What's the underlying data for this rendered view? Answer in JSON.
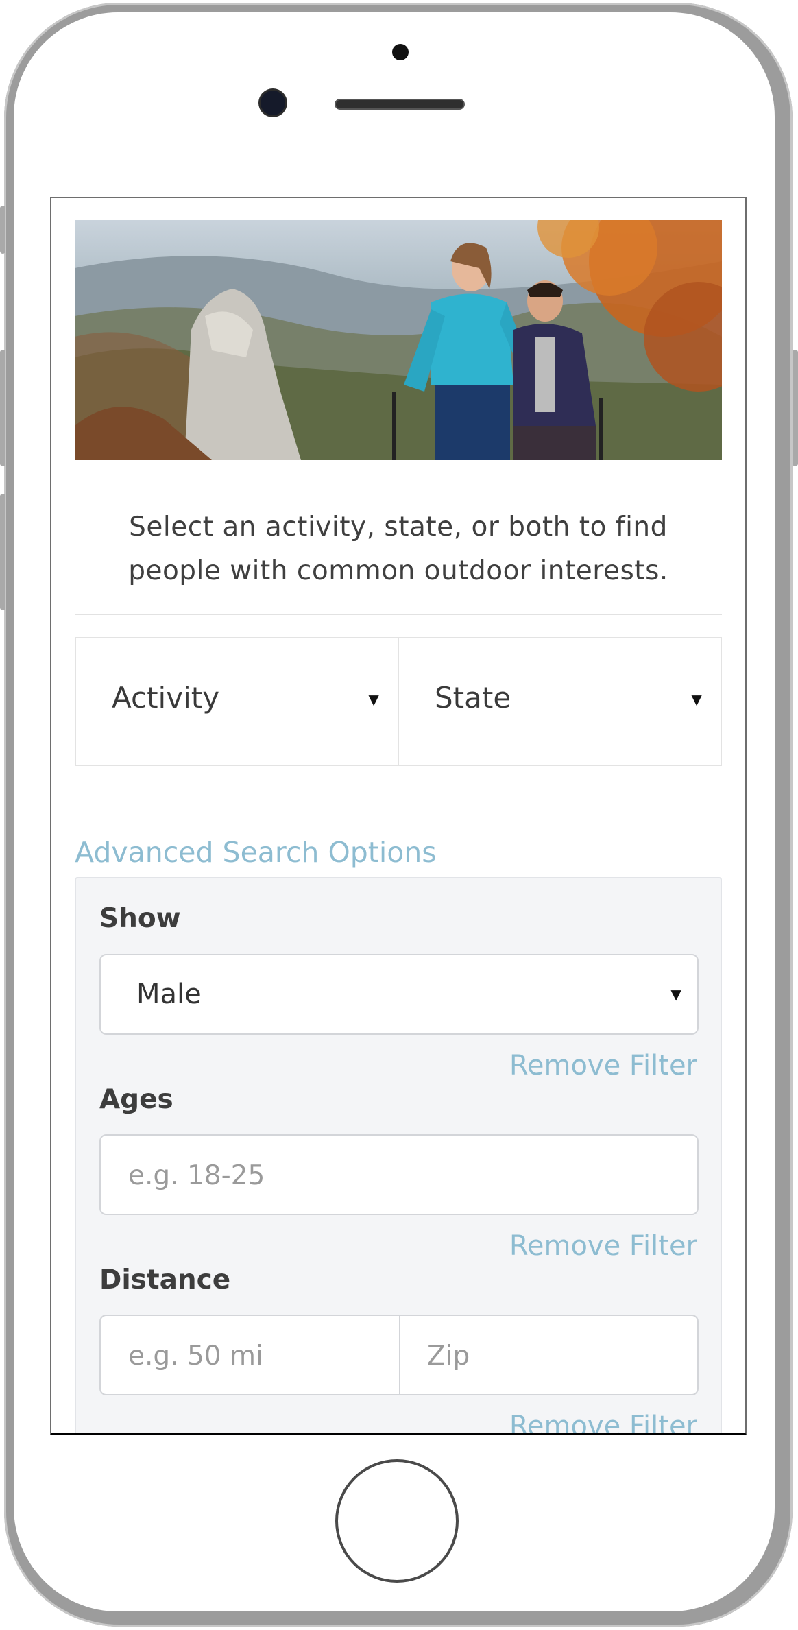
{
  "intro": {
    "line1": "Select an activity, state, or both to find",
    "line2": "people with common outdoor interests."
  },
  "selects": {
    "activity": "Activity",
    "state": "State",
    "caret": "▼"
  },
  "advanced": {
    "link": "Advanced Search Options",
    "show_label": "Show",
    "show_value": "Male",
    "ages_label": "Ages",
    "ages_placeholder": "e.g. 18-25",
    "distance_label": "Distance",
    "distance_placeholder": "e.g. 50 mi",
    "zip_placeholder": "Zip",
    "remove_filter": "Remove Filter"
  },
  "colors": {
    "link": "#8dbcd1",
    "panel_bg": "#f4f5f7",
    "text": "#3d3d3d"
  },
  "icons": [
    "caret-down-icon",
    "home-button",
    "front-camera"
  ]
}
